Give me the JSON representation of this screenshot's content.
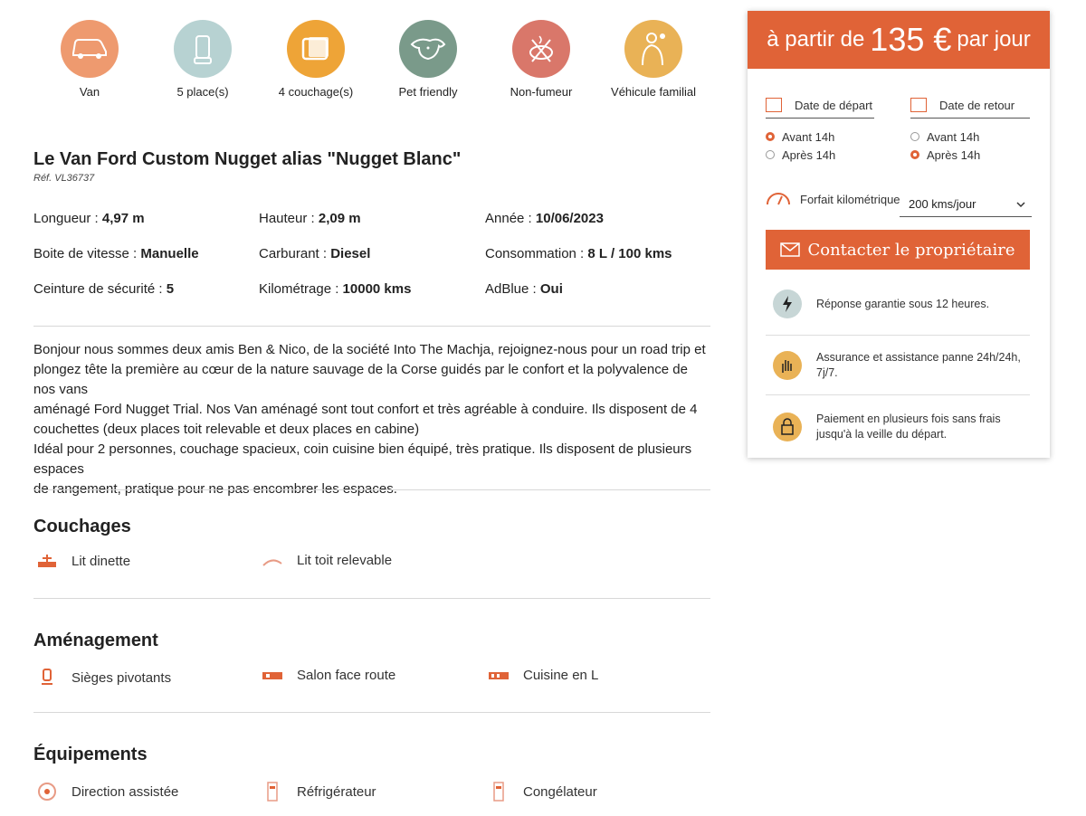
{
  "features": [
    {
      "label": "Van",
      "icon": "van-icon",
      "color": "#ee9a6f"
    },
    {
      "label": "5 place(s)",
      "icon": "seat-icon",
      "color": "#b7d2d2"
    },
    {
      "label": "4 couchage(s)",
      "icon": "pillow-icon",
      "color": "#eea437"
    },
    {
      "label": "Pet friendly",
      "icon": "dog-icon",
      "color": "#7a9a8a"
    },
    {
      "label": "Non-fumeur",
      "icon": "no-smoking-icon",
      "color": "#d9776a"
    },
    {
      "label": "Véhicule familial",
      "icon": "family-icon",
      "color": "#e9b256"
    }
  ],
  "vehicle": {
    "title": "Le Van Ford Custom Nugget alias \"Nugget Blanc\"",
    "ref": "Réf. VL36737"
  },
  "specs": [
    {
      "label": "Longueur : ",
      "value": "4,97 m"
    },
    {
      "label": "Hauteur : ",
      "value": "2,09 m"
    },
    {
      "label": "Année : ",
      "value": "10/06/2023"
    },
    {
      "label": "Boite de vitesse : ",
      "value": "Manuelle"
    },
    {
      "label": "Carburant : ",
      "value": "Diesel"
    },
    {
      "label": "Consommation : ",
      "value": "8 L / 100 kms"
    },
    {
      "label": "Ceinture de sécurité : ",
      "value": "5"
    },
    {
      "label": "Kilométrage : ",
      "value": "10000 kms"
    },
    {
      "label": "AdBlue : ",
      "value": "Oui"
    }
  ],
  "description": {
    "line1": "Bonjour nous sommes deux amis Ben & Nico, de la société Into The Machja, rejoignez-nous pour un road trip et",
    "line2": "plongez tête la première au cœur de la nature sauvage de la Corse guidés par le confort et la polyvalence de nos vans",
    "line3": "aménagé Ford Nugget Trial. Nos Van aménagé sont tout confort et très agréable à conduire. Ils disposent de 4",
    "line4": "couchettes (deux places toit relevable et deux places en cabine)",
    "line5": "Idéal pour 2 personnes, couchage spacieux, coin cuisine bien équipé, très pratique. Ils disposent de plusieurs espaces",
    "line6": "de rangement, pratique pour ne pas encombrer les espaces."
  },
  "sections": {
    "couchages": {
      "title": "Couchages",
      "items": [
        "Lit dinette",
        "Lit toit relevable"
      ]
    },
    "amenagement": {
      "title": "Aménagement",
      "items": [
        "Sièges pivotants",
        "Salon face route",
        "Cuisine en L"
      ]
    },
    "equipements": {
      "title": "Équipements",
      "items": [
        "Direction assistée",
        "Réfrigérateur",
        "Congélateur"
      ]
    }
  },
  "booking": {
    "price_prefix": "à partir de",
    "price_amount": "135 €",
    "price_suffix": "par jour",
    "departure_placeholder": "Date de départ",
    "return_placeholder": "Date de retour",
    "before": "Avant 14h",
    "after": "Après 14h",
    "forfait_label": "Forfait kilométrique",
    "forfait_value": "200 kms/jour",
    "contact_label": "Contacter le propriétaire",
    "perks": [
      "Réponse garantie sous 12 heures.",
      "Assurance et assistance panne 24h/24h, 7j/7.",
      "Paiement en plusieurs fois sans frais jusqu'à la veille du départ."
    ],
    "accent": "#e06337"
  }
}
